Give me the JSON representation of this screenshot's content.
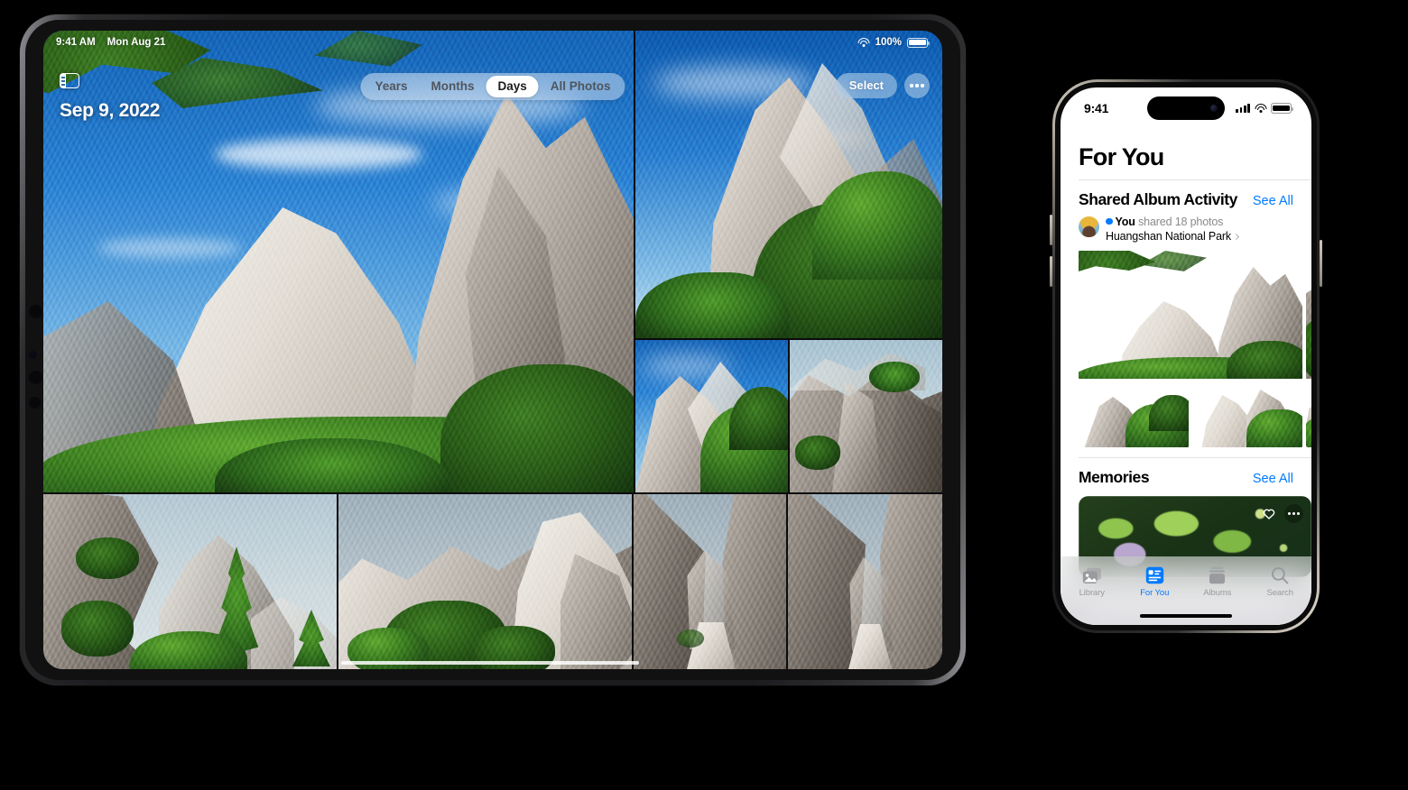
{
  "ipad": {
    "status": {
      "time": "9:41 AM",
      "date": "Mon Aug 21",
      "battery_pct": "100%",
      "wifi_icon": "wifi-icon",
      "battery_icon": "battery-icon"
    },
    "sidebar_toggle_icon": "sidebar-toggle-icon",
    "day_title": "Sep 9, 2022",
    "segments": [
      {
        "label": "Years",
        "selected": false
      },
      {
        "label": "Months",
        "selected": false
      },
      {
        "label": "Days",
        "selected": true
      },
      {
        "label": "All Photos",
        "selected": false
      }
    ],
    "select_label": "Select",
    "more_icon": "ellipsis-icon",
    "photos": [
      {
        "name": "huangshan-peak-pines",
        "alt": "Granite peak framed by pine branches under blue sky"
      },
      {
        "name": "huangshan-ridge-green",
        "alt": "Forested granite ridge with blue sky"
      },
      {
        "name": "huangshan-pine-slope",
        "alt": "Pine trees on a steep granite slope"
      },
      {
        "name": "huangshan-boulders",
        "alt": "Weathered granite boulders in mist"
      },
      {
        "name": "huangshan-cliff-trees",
        "alt": "Cliffside pines above a hazy valley"
      },
      {
        "name": "huangshan-rock-field",
        "alt": "Broad field of granite outcrops"
      },
      {
        "name": "huangshan-stair-canyon",
        "alt": "Stone stairway between two granite walls"
      },
      {
        "name": "huangshan-stair-canyon-2",
        "alt": "Stone stairway in a narrow rock gap"
      }
    ]
  },
  "iphone": {
    "status": {
      "time": "9:41",
      "cellular_icon": "cellular-bars-icon",
      "wifi_icon": "wifi-icon",
      "battery_icon": "battery-icon"
    },
    "title": "For You",
    "sections": [
      {
        "name": "shared-album-activity",
        "title": "Shared Album Activity",
        "action_label": "See All",
        "activity": {
          "avatar": "user-avatar",
          "actor": "You",
          "action": "shared 18 photos",
          "album": "Huangshan National Park",
          "chevron_icon": "chevron-right-icon"
        }
      },
      {
        "name": "memories",
        "title": "Memories",
        "action_label": "See All",
        "card": {
          "name": "memory-card",
          "favorite_icon": "heart-icon",
          "more_icon": "ellipsis-icon"
        }
      }
    ],
    "tabs": [
      {
        "label": "Library",
        "icon": "photos-library-icon",
        "selected": false
      },
      {
        "label": "For You",
        "icon": "for-you-icon",
        "selected": true
      },
      {
        "label": "Albums",
        "icon": "albums-icon",
        "selected": false
      },
      {
        "label": "Search",
        "icon": "search-icon",
        "selected": false
      }
    ],
    "accent_color": "#007aff"
  }
}
